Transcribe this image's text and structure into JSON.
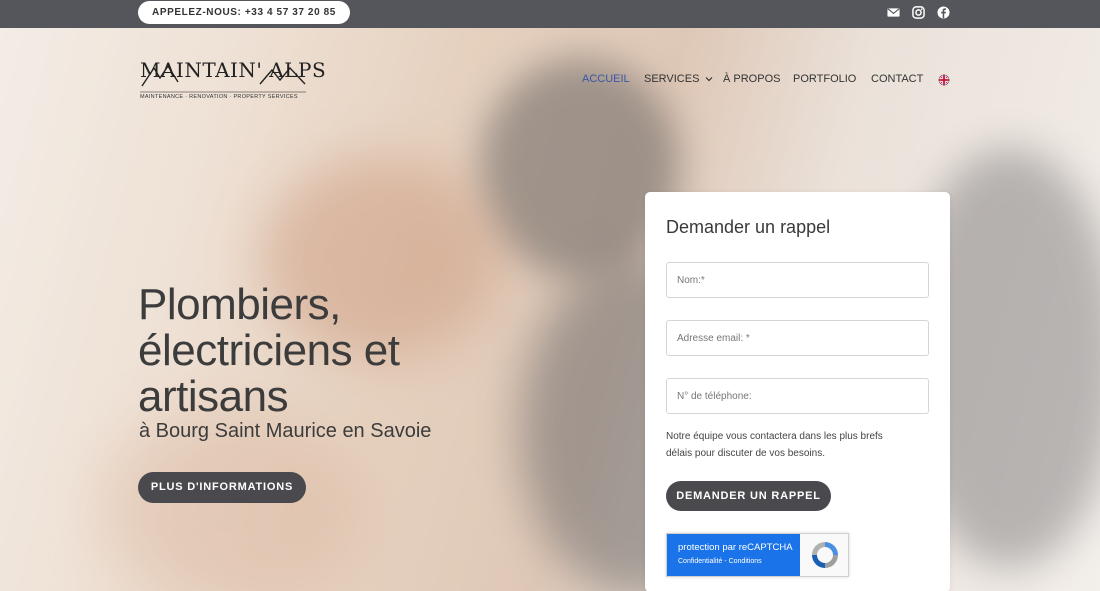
{
  "topbar": {
    "phone_label": "APPELEZ-NOUS: +33 4 57 37 20 85",
    "social": [
      {
        "icon": "mail-icon"
      },
      {
        "icon": "instagram-icon"
      },
      {
        "icon": "facebook-icon"
      }
    ]
  },
  "logo": {
    "name": "MAINTAIN' ALPS",
    "tagline": "MAINTENANCE · RENOVATION · PROPERTY SERVICES"
  },
  "nav": {
    "items": [
      {
        "label": "ACCUEIL",
        "active": true
      },
      {
        "label": "SERVICES"
      },
      {
        "label": "À PROPOS"
      },
      {
        "label": "PORTFOLIO"
      },
      {
        "label": "CONTACT"
      }
    ],
    "language_flag": "uk-flag-icon"
  },
  "hero": {
    "title": "Plombiers, électriciens et artisans",
    "subtitle": "à Bourg Saint Maurice en Savoie",
    "cta_label": "PLUS D'INFORMATIONS"
  },
  "form": {
    "title": "Demander un rappel",
    "fields": {
      "name_placeholder": "Nom:*",
      "email_placeholder": "Adresse email: *",
      "phone_placeholder": "N° de téléphone:"
    },
    "note": "Notre équipe vous contactera dans les plus brefs délais pour discuter de vos besoins.",
    "submit_label": "DEMANDER UN RAPPEL",
    "recaptcha": {
      "title": "protection par reCAPTCHA",
      "links": "Confidentialité - Conditions"
    }
  },
  "colors": {
    "topbar": "#55565b",
    "button": "#4a4a4e",
    "nav_active": "#3c55a5",
    "recaptcha_blue": "#1a73e8"
  }
}
